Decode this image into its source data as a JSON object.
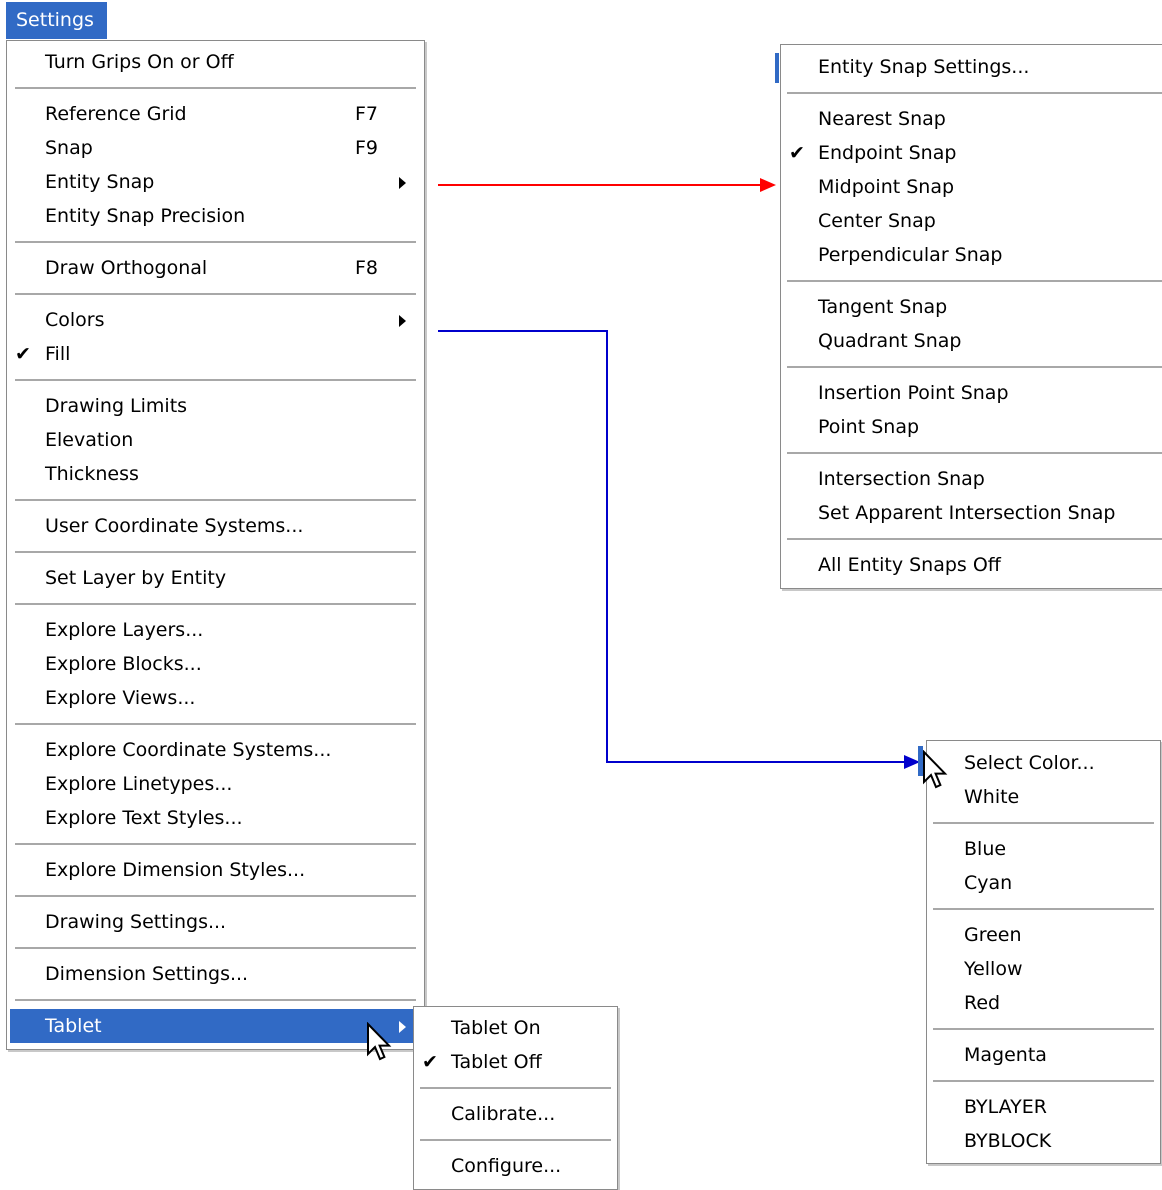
{
  "menubar": {
    "settings": "Settings"
  },
  "settings_menu": {
    "items": [
      {
        "label": "Turn Grips On or Off",
        "shortcut": "",
        "checked": false,
        "submenu": false
      },
      {
        "label": "Reference Grid",
        "shortcut": "F7",
        "checked": false,
        "submenu": false
      },
      {
        "label": "Snap",
        "shortcut": "F9",
        "checked": false,
        "submenu": false
      },
      {
        "label": "Entity Snap",
        "shortcut": "",
        "checked": false,
        "submenu": true
      },
      {
        "label": "Entity Snap Precision",
        "shortcut": "",
        "checked": false,
        "submenu": false
      },
      {
        "label": "Draw Orthogonal",
        "shortcut": "F8",
        "checked": false,
        "submenu": false
      },
      {
        "label": "Colors",
        "shortcut": "",
        "checked": false,
        "submenu": true
      },
      {
        "label": "Fill",
        "shortcut": "",
        "checked": true,
        "submenu": false
      },
      {
        "label": "Drawing Limits",
        "shortcut": "",
        "checked": false,
        "submenu": false
      },
      {
        "label": "Elevation",
        "shortcut": "",
        "checked": false,
        "submenu": false
      },
      {
        "label": "Thickness",
        "shortcut": "",
        "checked": false,
        "submenu": false
      },
      {
        "label": "User Coordinate Systems...",
        "shortcut": "",
        "checked": false,
        "submenu": false
      },
      {
        "label": "Set Layer by Entity",
        "shortcut": "",
        "checked": false,
        "submenu": false
      },
      {
        "label": "Explore Layers...",
        "shortcut": "",
        "checked": false,
        "submenu": false
      },
      {
        "label": "Explore Blocks...",
        "shortcut": "",
        "checked": false,
        "submenu": false
      },
      {
        "label": "Explore Views...",
        "shortcut": "",
        "checked": false,
        "submenu": false
      },
      {
        "label": "Explore Coordinate Systems...",
        "shortcut": "",
        "checked": false,
        "submenu": false
      },
      {
        "label": "Explore Linetypes...",
        "shortcut": "",
        "checked": false,
        "submenu": false
      },
      {
        "label": "Explore Text Styles...",
        "shortcut": "",
        "checked": false,
        "submenu": false
      },
      {
        "label": "Explore Dimension Styles...",
        "shortcut": "",
        "checked": false,
        "submenu": false
      },
      {
        "label": "Drawing Settings...",
        "shortcut": "",
        "checked": false,
        "submenu": false
      },
      {
        "label": "Dimension Settings...",
        "shortcut": "",
        "checked": false,
        "submenu": false
      },
      {
        "label": "Tablet",
        "shortcut": "",
        "checked": false,
        "submenu": true,
        "highlighted": true
      }
    ]
  },
  "entity_snap_menu": {
    "items": [
      {
        "label": "Entity Snap Settings...",
        "checked": false
      },
      {
        "label": "Nearest Snap",
        "checked": false
      },
      {
        "label": "Endpoint Snap",
        "checked": true
      },
      {
        "label": "Midpoint Snap",
        "checked": false
      },
      {
        "label": "Center Snap",
        "checked": false
      },
      {
        "label": "Perpendicular Snap",
        "checked": false
      },
      {
        "label": "Tangent Snap",
        "checked": false
      },
      {
        "label": "Quadrant Snap",
        "checked": false
      },
      {
        "label": "Insertion Point Snap",
        "checked": false
      },
      {
        "label": "Point Snap",
        "checked": false
      },
      {
        "label": "Intersection Snap",
        "checked": false
      },
      {
        "label": "Set Apparent Intersection Snap",
        "checked": false
      },
      {
        "label": "All Entity Snaps Off",
        "checked": false
      }
    ]
  },
  "colors_menu": {
    "items": [
      {
        "label": "Select Color...",
        "checked": false
      },
      {
        "label": "White",
        "checked": false
      },
      {
        "label": "Blue",
        "checked": false
      },
      {
        "label": "Cyan",
        "checked": false
      },
      {
        "label": "Green",
        "checked": false
      },
      {
        "label": "Yellow",
        "checked": false
      },
      {
        "label": "Red",
        "checked": false
      },
      {
        "label": "Magenta",
        "checked": false
      },
      {
        "label": "BYLAYER",
        "checked": false
      },
      {
        "label": "BYBLOCK",
        "checked": false
      }
    ]
  },
  "tablet_menu": {
    "items": [
      {
        "label": "Tablet On",
        "checked": false
      },
      {
        "label": "Tablet Off",
        "checked": true
      },
      {
        "label": "Calibrate...",
        "checked": false
      },
      {
        "label": "Configure...",
        "checked": false
      }
    ]
  },
  "colors": {
    "highlight": "#316ac5",
    "entity_snap_connector": "#ff0000",
    "colors_connector": "#0000cc"
  }
}
